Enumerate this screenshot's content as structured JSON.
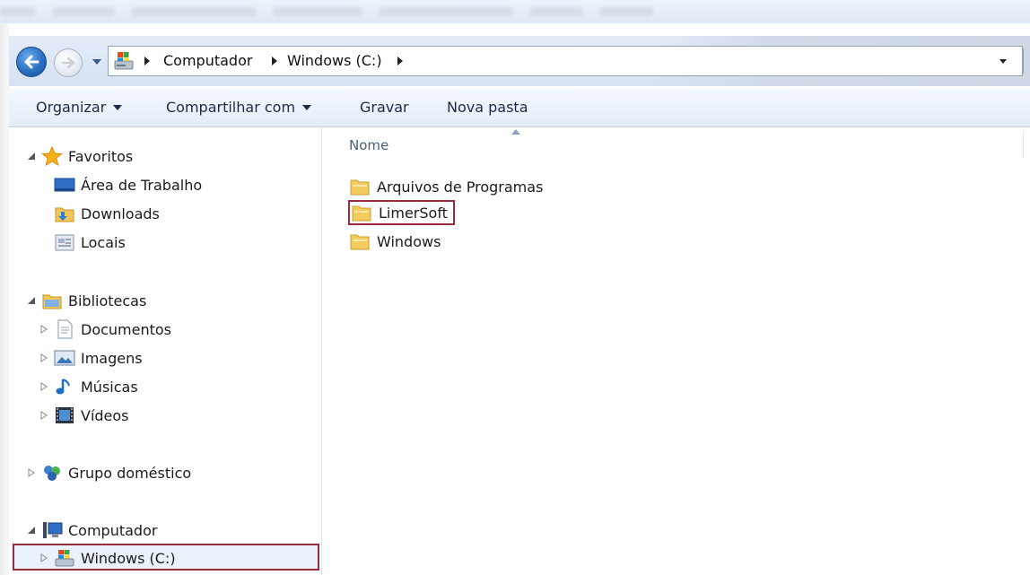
{
  "address_bar": {
    "crumbs": [
      "Computador",
      "Windows (C:)"
    ]
  },
  "toolbar": {
    "organize": "Organizar",
    "share": "Compartilhar com",
    "burn": "Gravar",
    "new_folder": "Nova pasta"
  },
  "nav_pane": {
    "favorites": {
      "label": "Favoritos",
      "icon": "star-icon",
      "items": [
        {
          "label": "Área de Trabalho",
          "icon": "desktop-icon"
        },
        {
          "label": "Downloads",
          "icon": "downloads-icon"
        },
        {
          "label": "Locais",
          "icon": "recent-places-icon"
        }
      ]
    },
    "libraries": {
      "label": "Bibliotecas",
      "icon": "libraries-icon",
      "items": [
        {
          "label": "Documentos",
          "icon": "documents-icon"
        },
        {
          "label": "Imagens",
          "icon": "pictures-icon"
        },
        {
          "label": "Músicas",
          "icon": "music-icon"
        },
        {
          "label": "Vídeos",
          "icon": "videos-icon"
        }
      ]
    },
    "homegroup": {
      "label": "Grupo doméstico",
      "icon": "homegroup-icon"
    },
    "computer": {
      "label": "Computador",
      "icon": "computer-icon",
      "items": [
        {
          "label": "Windows (C:)",
          "icon": "drive-icon",
          "selected": true
        }
      ]
    }
  },
  "content": {
    "column_header": "Nome",
    "items": [
      {
        "name": "Arquivos de Programas",
        "type": "folder"
      },
      {
        "name": "LimerSoft",
        "type": "folder",
        "highlighted": true
      },
      {
        "name": "Windows",
        "type": "folder"
      }
    ]
  },
  "colors": {
    "highlight_border": "#9b2a3c",
    "toolbar_text": "#1d2b4a",
    "header_text": "#4c607a"
  }
}
